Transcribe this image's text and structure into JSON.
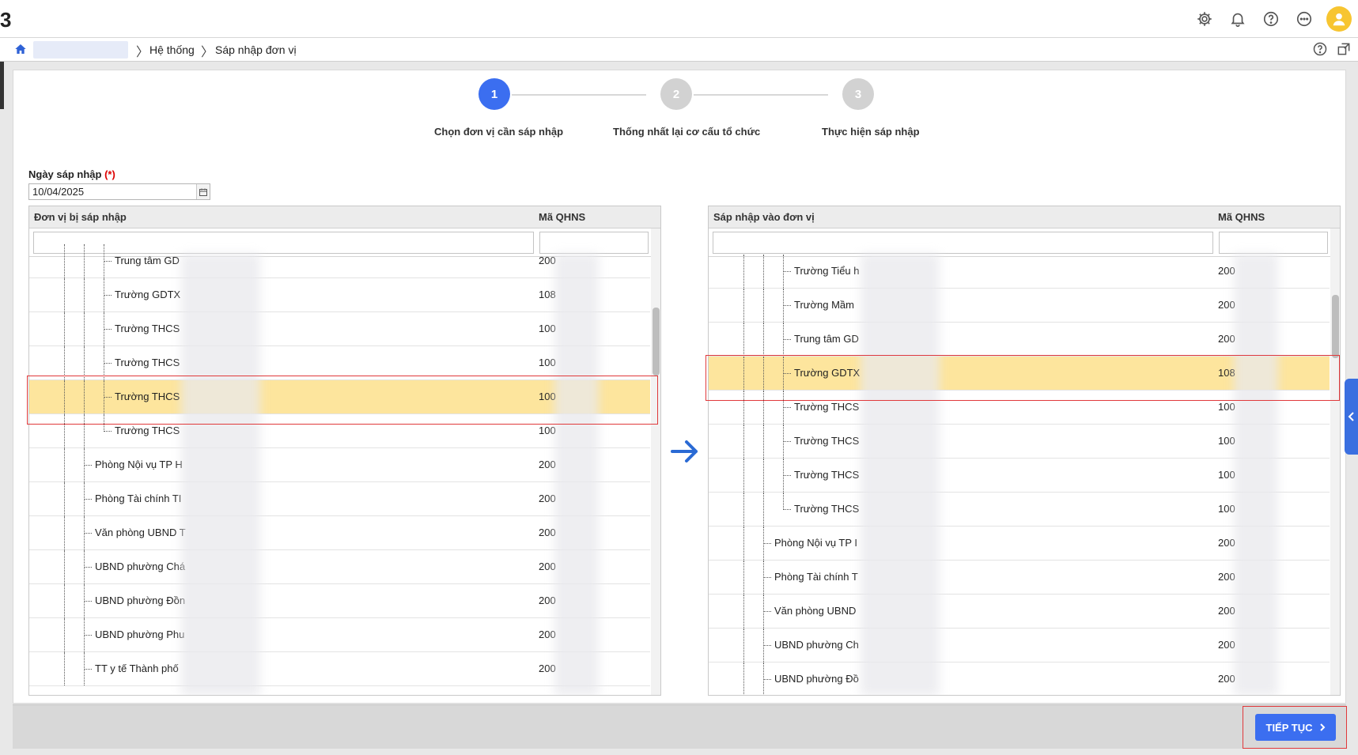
{
  "topbar": {
    "logo_fragment": "3",
    "icons": [
      "gear-icon",
      "bell-icon",
      "help-icon",
      "more-icon",
      "user-icon"
    ]
  },
  "breadcrumb": {
    "items": [
      "Hệ thống",
      "Sáp nhập đơn vị"
    ]
  },
  "stepper": {
    "steps": [
      {
        "number": "1",
        "label": "Chọn đơn vị cần sáp nhập",
        "active": true
      },
      {
        "number": "2",
        "label": "Thống nhất lại cơ cấu tổ chức",
        "active": false
      },
      {
        "number": "3",
        "label": "Thực hiện sáp nhập",
        "active": false
      }
    ],
    "active_color": "#3b6ef0",
    "inactive_color": "#d2d2d2"
  },
  "form": {
    "date_label": "Ngày sáp nhập",
    "required_mark": "(*)",
    "date_value": "10/04/2025"
  },
  "left_grid": {
    "col_name": "Đơn vị bị sáp nhập",
    "col_code": "Mã QHNS",
    "rows": [
      {
        "name": "Trung tâm GD",
        "code": "200",
        "level": 3
      },
      {
        "name": "Trường GDTX",
        "code": "108",
        "level": 3
      },
      {
        "name": "Trường THCS",
        "code": "100",
        "level": 3
      },
      {
        "name": "Trường THCS",
        "code": "100",
        "level": 3
      },
      {
        "name": "Trường THCS",
        "code": "100",
        "level": 3,
        "selected": true
      },
      {
        "name": "Trường THCS",
        "code": "100",
        "level": 3,
        "last": true
      },
      {
        "name": "Phòng Nội vụ TP H",
        "code": "200",
        "level": 2
      },
      {
        "name": "Phòng Tài chính TI",
        "code": "200",
        "level": 2
      },
      {
        "name": "Văn phòng UBND T",
        "code": "200",
        "level": 2
      },
      {
        "name": "UBND phường Chá",
        "code": "200",
        "level": 2
      },
      {
        "name": "UBND phường Đồn",
        "code": "200",
        "level": 2
      },
      {
        "name": "UBND phường Phu",
        "code": "200",
        "level": 2
      },
      {
        "name": "TT y tế Thành phố",
        "code": "200",
        "level": 2
      }
    ]
  },
  "right_grid": {
    "col_name": "Sáp nhập vào đơn vị",
    "col_code": "Mã QHNS",
    "rows": [
      {
        "name": "Trường Tiểu h",
        "code": "200",
        "level": 3
      },
      {
        "name": "Trường Mầm",
        "code": "200",
        "level": 3
      },
      {
        "name": "Trung tâm GD",
        "code": "200",
        "level": 3
      },
      {
        "name": "Trường GDTX",
        "code": "108",
        "level": 3,
        "selected": true
      },
      {
        "name": "Trường THCS",
        "code": "100",
        "level": 3
      },
      {
        "name": "Trường THCS",
        "code": "100",
        "level": 3
      },
      {
        "name": "Trường THCS",
        "code": "100",
        "level": 3
      },
      {
        "name": "Trường THCS",
        "code": "100",
        "level": 3,
        "last": true
      },
      {
        "name": "Phòng Nội vụ TP I",
        "code": "200",
        "level": 2
      },
      {
        "name": "Phòng Tài chính T",
        "code": "200",
        "level": 2
      },
      {
        "name": "Văn phòng UBND",
        "code": "200",
        "level": 2
      },
      {
        "name": "UBND phường Ch",
        "code": "200",
        "level": 2
      },
      {
        "name": "UBND phường Đồ",
        "code": "200",
        "level": 2
      }
    ]
  },
  "footer": {
    "next_label": "TIẾP TỤC"
  },
  "colors": {
    "selected_row": "#fde59d",
    "accent": "#3b6ef0",
    "highlight_border": "#e0393b"
  }
}
